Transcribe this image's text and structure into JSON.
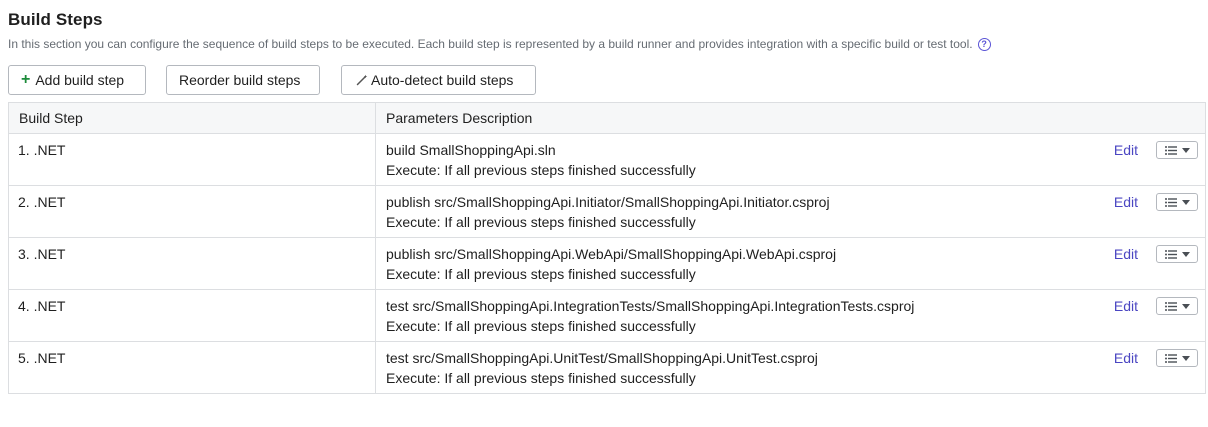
{
  "header": {
    "title": "Build Steps",
    "description": "In this section you can configure the sequence of build steps to be executed. Each build step is represented by a build runner and provides integration with a specific build or test tool."
  },
  "toolbar": {
    "add_label": "Add build step",
    "reorder_label": "Reorder build steps",
    "autodetect_label": "Auto-detect build steps"
  },
  "table": {
    "headers": {
      "step": "Build Step",
      "params": "Parameters Description"
    },
    "edit_label": "Edit",
    "rows": [
      {
        "name": "1. .NET",
        "command": "build SmallShoppingApi.sln",
        "execute": "Execute: If all previous steps finished successfully"
      },
      {
        "name": "2. .NET",
        "command": "publish src/SmallShoppingApi.Initiator/SmallShoppingApi.Initiator.csproj",
        "execute": "Execute: If all previous steps finished successfully"
      },
      {
        "name": "3. .NET",
        "command": "publish src/SmallShoppingApi.WebApi/SmallShoppingApi.WebApi.csproj",
        "execute": "Execute: If all previous steps finished successfully"
      },
      {
        "name": "4. .NET",
        "command": "test src/SmallShoppingApi.IntegrationTests/SmallShoppingApi.IntegrationTests.csproj",
        "execute": "Execute: If all previous steps finished successfully"
      },
      {
        "name": "5. .NET",
        "command": "test src/SmallShoppingApi.UnitTest/SmallShoppingApi.UnitTest.csproj",
        "execute": "Execute: If all previous steps finished successfully"
      }
    ]
  },
  "icons": {
    "help": "help-circle-icon",
    "add": "plus-icon",
    "autodetect": "magic-wand-icon",
    "row_actions": "list-icon",
    "dropdown": "chevron-down-icon"
  },
  "colors": {
    "accent": "#4b46c2",
    "add_icon": "#1c8b3a",
    "border": "#dcdee1",
    "header_bg": "#f6f7f8"
  }
}
